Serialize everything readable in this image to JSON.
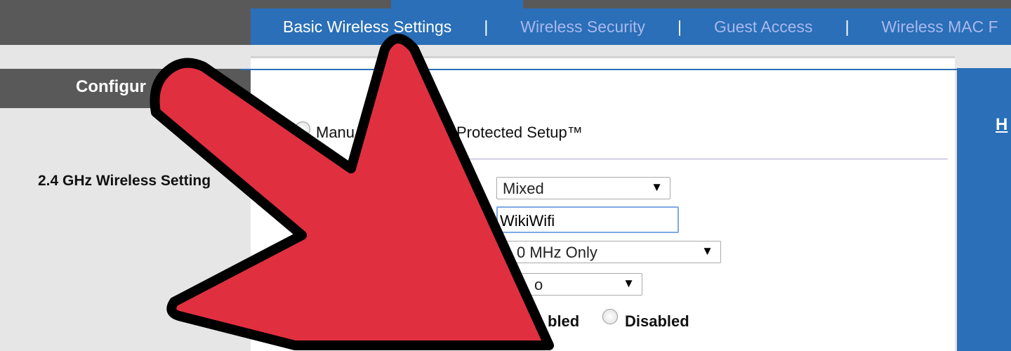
{
  "nav": {
    "tabs": [
      {
        "label": "Basic Wireless Settings",
        "active": true
      },
      {
        "label": "Wireless Security"
      },
      {
        "label": "Guest Access"
      },
      {
        "label": "Wireless MAC F"
      }
    ],
    "separator": "|"
  },
  "sidebar": {
    "heading": "Configur",
    "section_label": "2.4 GHz Wireless Setting"
  },
  "help_link": "H",
  "setup": {
    "manual_label": "Manu",
    "wps_label": "Protected Setup™"
  },
  "form": {
    "network_mode": "Mixed",
    "ssid": "WikiWifi",
    "channel_width": "0 MHz Only",
    "channel": "o",
    "ssid_broadcast": {
      "enabled_label": "bled",
      "disabled_label": "Disabled"
    }
  },
  "colors": {
    "accent": "#2a6fb7",
    "arrow": "#e03040",
    "header": "#595959"
  }
}
